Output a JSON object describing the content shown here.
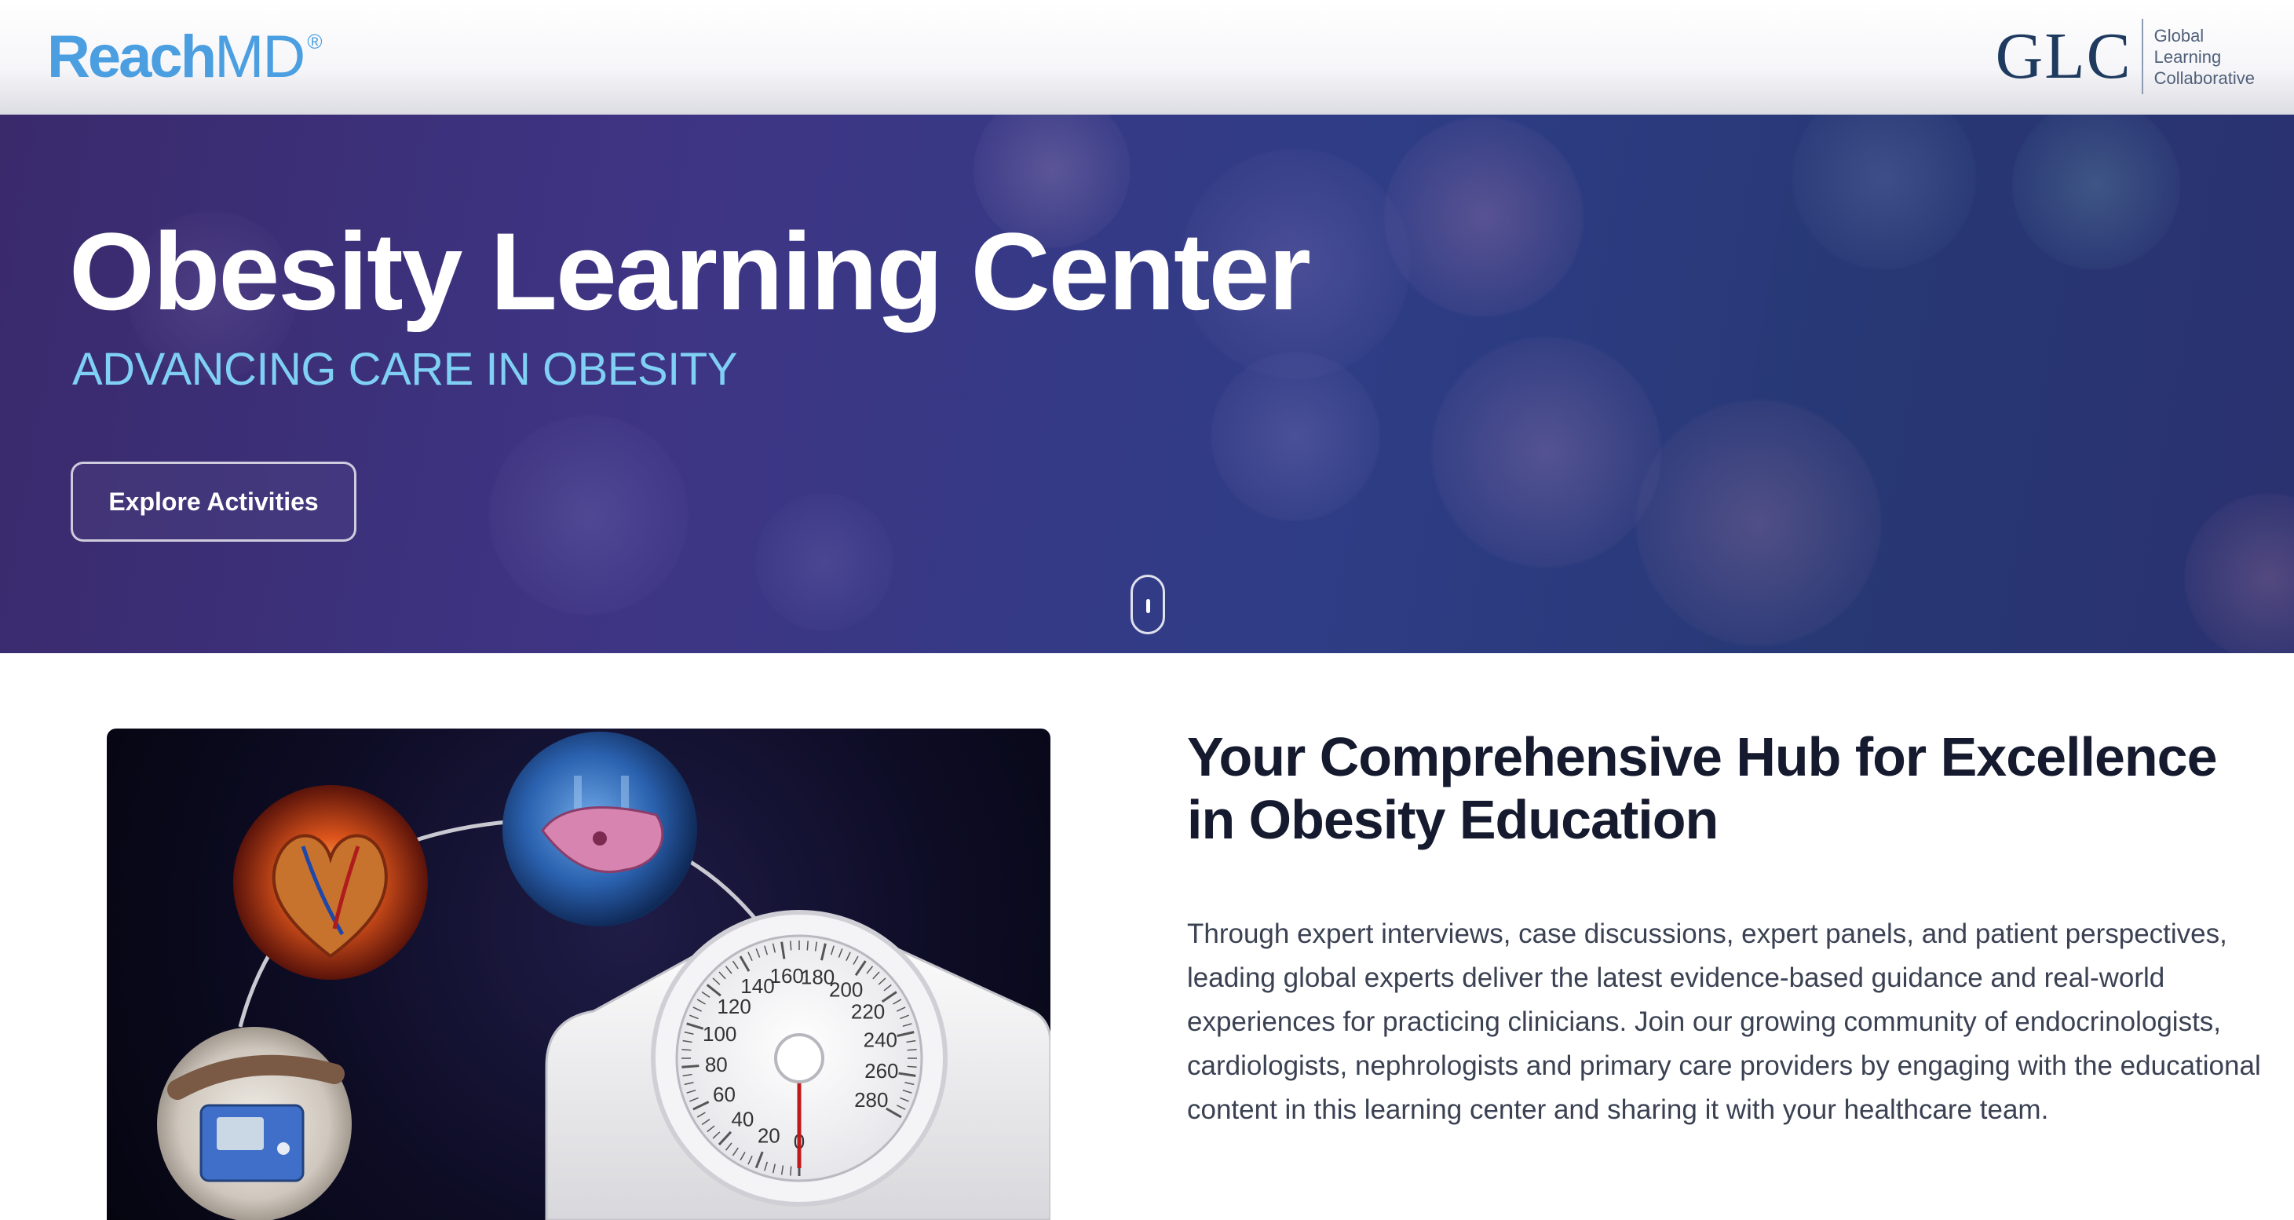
{
  "header": {
    "brand": {
      "reach": "Reach",
      "md": "MD",
      "registered": "®"
    },
    "partner": {
      "mark": "GLC",
      "lines": [
        "Global",
        "Learning",
        "Collaborative"
      ]
    }
  },
  "hero": {
    "title": "Obesity Learning Center",
    "subtitle": "ADVANCING CARE IN OBESITY",
    "cta_label": "Explore Activities"
  },
  "content": {
    "title": "Your Comprehensive Hub for Excellence in Obesity Education",
    "body": "Through expert interviews, case discussions, expert panels, and patient perspectives, leading global experts deliver the latest evidence-based guidance and real-world experiences for practicing clinicians. Join our growing community of endocrinologists, cardiologists, nephrologists and primary care providers by engaging with the educational content in this learning center and sharing it with your healthcare team."
  },
  "scale_dial": {
    "ticks": [
      "0",
      "20",
      "40",
      "60",
      "80",
      "100",
      "120",
      "140",
      "160",
      "180",
      "200",
      "220",
      "240",
      "260",
      "280"
    ]
  },
  "colors": {
    "brand_blue": "#4b9fe1",
    "hero_subtitle": "#7fd0f4",
    "hero_bg": "#3a3580",
    "heading": "#151a2e",
    "body_text": "#3a4152",
    "glc_navy": "#1e3a5f"
  },
  "icons": [
    "scroll-mouse-icon",
    "heart-illustration-icon",
    "lungs-liver-illustration-icon",
    "blood-pressure-cuff-illustration-icon",
    "bathroom-scale-illustration-icon"
  ]
}
